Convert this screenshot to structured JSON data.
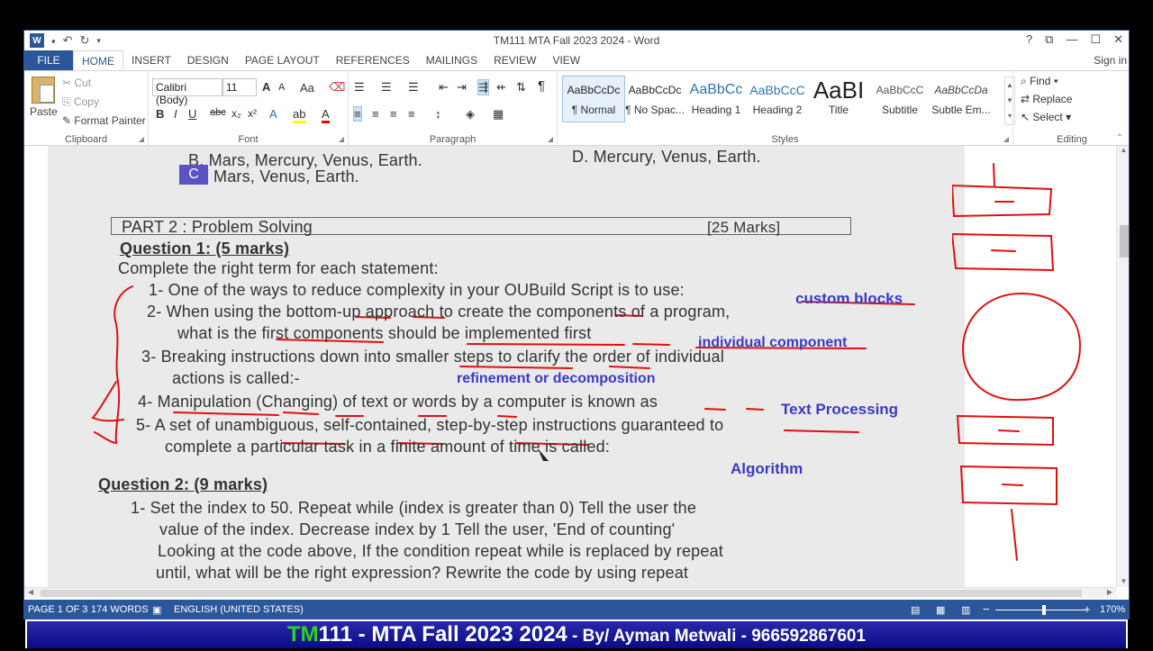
{
  "window": {
    "title": "TM111 MTA Fall 2023 2024 - Word",
    "app_icon": "W",
    "controls": [
      "?",
      "⧉",
      "—",
      "☐",
      "✕"
    ]
  },
  "tabs": [
    "FILE",
    "HOME",
    "INSERT",
    "DESIGN",
    "PAGE LAYOUT",
    "REFERENCES",
    "MAILINGS",
    "REVIEW",
    "VIEW"
  ],
  "sign_in": "Sign in",
  "clipboard": {
    "paste": "Paste",
    "cut": "Cut",
    "copy": "Copy",
    "format_painter": "Format Painter",
    "label": "Clipboard"
  },
  "font": {
    "name": "Calibri (Body)",
    "size": "11",
    "label": "Font"
  },
  "paragraph": {
    "label": "Paragraph"
  },
  "styles": {
    "label": "Styles",
    "items": [
      {
        "sample": "AaBbCcDc",
        "name": "¶ Normal"
      },
      {
        "sample": "AaBbCcDc",
        "name": "¶ No Spac..."
      },
      {
        "sample": "AaBbCc",
        "name": "Heading 1"
      },
      {
        "sample": "AaBbCcC",
        "name": "Heading 2"
      },
      {
        "sample": "AaBI",
        "name": "Title"
      },
      {
        "sample": "AaBbCcC",
        "name": "Subtitle"
      },
      {
        "sample": "AaBbCcDa",
        "name": "Subtle Em..."
      }
    ]
  },
  "editing": {
    "label": "Editing",
    "find": "Find",
    "replace": "Replace",
    "select": "Select"
  },
  "document": {
    "option_b": "B. Mars, Mercury, Venus, Earth.",
    "option_c_letter": "C",
    "option_c": "Mars, Venus, Earth.",
    "option_d": "D. Mercury, Venus, Earth.",
    "part_title": "PART 2 : Problem Solving",
    "part_marks": "[25 Marks]",
    "q1_title": "Question 1: (5 marks)",
    "q1_intro": "Complete the right term for each statement:",
    "q1_items": [
      "1-  One of the ways to reduce complexity in your OUBuild Script is to use:",
      "2-  When using the bottom-up approach to create the components of a program,",
      "what is the first components should be implemented first",
      "3-  Breaking instructions down into smaller steps to clarify the order of individual",
      "actions is called:-",
      "4-  Manipulation (Changing) of text or words by a computer is known as",
      "5-  A set of unambiguous, self-contained, step-by-step instructions guaranteed to",
      "complete a particular task in a finite amount of time is called:"
    ],
    "answers": [
      "custom blocks",
      "individual component",
      "refinement or decomposition",
      "Text Processing",
      "Algorithm"
    ],
    "q2_title": "Question 2: (9 marks)",
    "q2_lines": [
      "1-  Set the index to 50. Repeat while (index is greater than 0) Tell the user the",
      "value of the index. Decrease index by 1 Tell the user, 'End of counting'",
      "Looking at the code above, If the condition repeat while is replaced by repeat",
      "until, what will be the right expression? Rewrite the code by using repeat"
    ]
  },
  "status": {
    "page": "PAGE 1 OF 3",
    "words": "174 WORDS",
    "language": "ENGLISH (UNITED STATES)",
    "zoom": "170%",
    "zoom_minus": "−",
    "zoom_plus": "+"
  },
  "banner": {
    "tm": "TM",
    "main": "111 - MTA Fall 2023 2024",
    "by": " - By/ Ayman Metwali - 966592867601"
  }
}
